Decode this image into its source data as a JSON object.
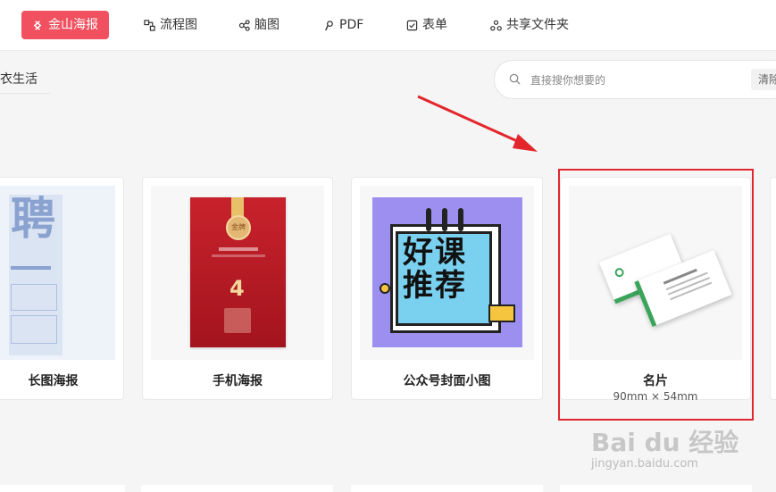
{
  "nav": {
    "tabs": [
      {
        "label": "金山海报",
        "icon": "poster-icon",
        "active": true
      },
      {
        "label": "流程图",
        "icon": "flowchart-icon"
      },
      {
        "label": "脑图",
        "icon": "mindmap-icon"
      },
      {
        "label": "PDF",
        "icon": "pdf-icon"
      },
      {
        "label": "表单",
        "icon": "form-icon"
      },
      {
        "label": "共享文件夹",
        "icon": "shared-folder-icon"
      }
    ]
  },
  "subnav": {
    "label": "衣生活"
  },
  "search": {
    "placeholder": "直接搜你想要的",
    "clear_label": "清除"
  },
  "cards": [
    {
      "title": "长图海报",
      "thumb_text": "聘"
    },
    {
      "title": "手机海报",
      "thumb_text_a": "金牌",
      "thumb_text_b": "4"
    },
    {
      "title": "公众号封面小图",
      "thumb_text_a": "好课",
      "thumb_text_b": "推荐"
    },
    {
      "title": "名片",
      "subtitle": "90mm × 54mm"
    }
  ],
  "watermark": {
    "brand": "Bai du 经验",
    "url": "jingyan.baidu.com"
  },
  "colors": {
    "accent": "#f0505f",
    "highlight": "#e0282c",
    "card_border": "#e8e8e8"
  }
}
